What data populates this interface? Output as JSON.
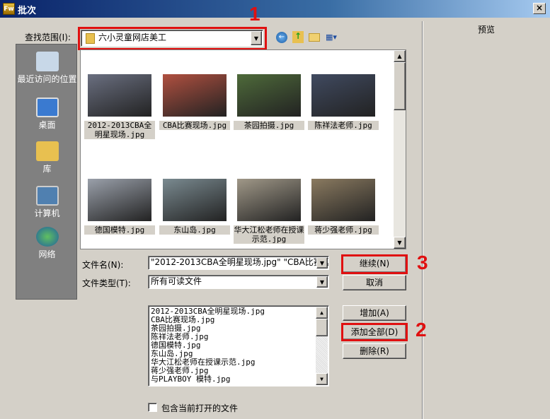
{
  "window": {
    "title": "批次",
    "app_icon": "Fw",
    "close": "×"
  },
  "lookin": {
    "label": "查找范围(I):",
    "value": "六小灵童网店美工"
  },
  "toolbar": {
    "back": "back-icon",
    "up": "up-folder-icon",
    "new_folder": "new-folder-icon",
    "views": "views-menu-icon"
  },
  "places": [
    {
      "label": "最近访问的位置"
    },
    {
      "label": "桌面"
    },
    {
      "label": "库"
    },
    {
      "label": "计算机"
    },
    {
      "label": "网络"
    }
  ],
  "files": [
    {
      "name": "2012-2013CBA全明星现场.jpg",
      "color": "#6a6f80",
      "selected": true
    },
    {
      "name": "CBA比赛现场.jpg",
      "color": "#b05040",
      "selected": true
    },
    {
      "name": "茶园拍摄.jpg",
      "color": "#4e6a3a",
      "selected": true
    },
    {
      "name": "陈祥法老师.jpg",
      "color": "#404a60",
      "selected": true
    },
    {
      "name": "德国模特.jpg",
      "color": "#9aa0aa",
      "selected": true
    },
    {
      "name": "东山岛.jpg",
      "color": "#7a8a90",
      "selected": true
    },
    {
      "name": "华大江松老师在授课示范.jpg",
      "color": "#a09888",
      "selected": true
    },
    {
      "name": "蒋少强老师.jpg",
      "color": "#8a7a60",
      "selected": true
    }
  ],
  "preview": {
    "label": "预览"
  },
  "filename": {
    "label": "文件名(N):",
    "value": "\"2012-2013CBA全明星现场.jpg\" \"CBA比赛现"
  },
  "filetype": {
    "label": "文件类型(T):",
    "value": "所有可读文件"
  },
  "buttons": {
    "continue": "继续(N)",
    "cancel": "取消",
    "add": "增加(A)",
    "add_all": "添加全部(D)",
    "remove": "删除(R)"
  },
  "batch_list": [
    "2012-2013CBA全明星现场.jpg",
    "CBA比赛现场.jpg",
    "茶园拍摄.jpg",
    "陈祥法老师.jpg",
    "德国模特.jpg",
    "东山岛.jpg",
    "华大江松老师在授课示范.jpg",
    "蒋少强老师.jpg",
    "与PLAYBOY 模特.jpg"
  ],
  "include_open": {
    "label": "包含当前打开的文件",
    "checked": false
  },
  "annotations": [
    "1",
    "2",
    "3"
  ],
  "colors": {
    "annotation": "#e01010",
    "title_bar": "#0a246a"
  }
}
